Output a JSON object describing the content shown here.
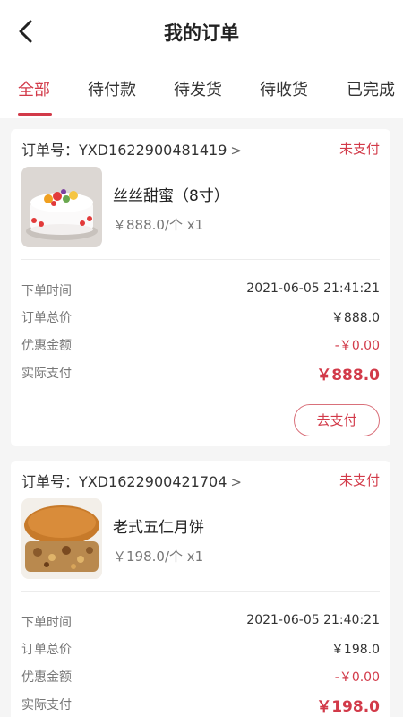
{
  "header": {
    "title": "我的订单",
    "back_icon": "chevron-left-icon"
  },
  "tabs": [
    {
      "label": "全部",
      "active": true
    },
    {
      "label": "待付款",
      "active": false
    },
    {
      "label": "待发货",
      "active": false
    },
    {
      "label": "待收货",
      "active": false
    },
    {
      "label": "已完成",
      "active": false
    }
  ],
  "orders": [
    {
      "order_no": "订单号：YXD1622900481419",
      "status": "未支付",
      "product_name": "丝丝甜蜜（8寸）",
      "product_price": "￥888.0/个 x1",
      "image": "cake-image",
      "fields": [
        {
          "label": "下单时间",
          "value": "2021-06-05 21:41:21"
        },
        {
          "label": "订单总价",
          "value": "￥888.0"
        },
        {
          "label": "优惠金额",
          "value": "-￥0.00"
        },
        {
          "label": "实际支付",
          "value": "￥888.0"
        }
      ],
      "action_label": "去支付"
    },
    {
      "order_no": "订单号：YXD1622900421704",
      "status": "未支付",
      "product_name": "老式五仁月饼",
      "product_price": "￥198.0/个 x1",
      "image": "mooncake-image",
      "fields": [
        {
          "label": "下单时间",
          "value": "2021-06-05 21:40:21"
        },
        {
          "label": "订单总价",
          "value": "￥198.0"
        },
        {
          "label": "优惠金额",
          "value": "-￥0.00"
        },
        {
          "label": "实际支付",
          "value": "￥198.0"
        }
      ]
    }
  ],
  "colors": {
    "accent": "#d23a49",
    "background": "#f5f5f5"
  }
}
